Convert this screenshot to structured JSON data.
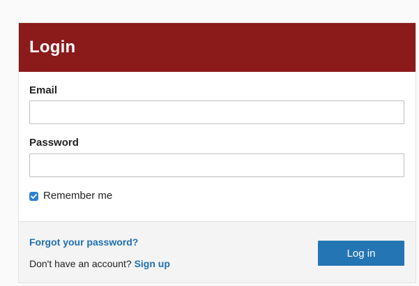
{
  "login_form": {
    "title": "Login",
    "email": {
      "label": "Email",
      "value": "",
      "placeholder": ""
    },
    "password": {
      "label": "Password",
      "value": "",
      "placeholder": ""
    },
    "remember_me": {
      "label": "Remember me",
      "checked": true
    },
    "forgot_password_link": "Forgot your password?",
    "signup_prompt": "Don't have an account?",
    "signup_link": "Sign up",
    "submit_label": "Log in"
  },
  "colors": {
    "header_background": "#8b1a1b",
    "link": "#1f6fb2",
    "button_background": "#2475b4",
    "checkbox_checked": "#2f80d6",
    "footer_background": "#f4f4f4"
  },
  "icons": {
    "checkbox": "checkmark-icon"
  }
}
